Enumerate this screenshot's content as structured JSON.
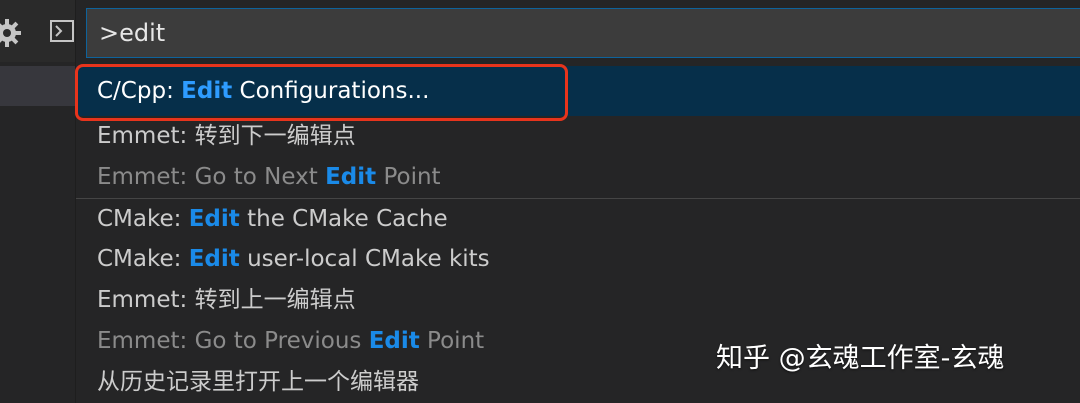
{
  "command_palette": {
    "input_value": ">edit",
    "items": [
      {
        "prefix": "C/Cpp: ",
        "match": "Edit",
        "suffix": " Configurations...",
        "selected": true
      },
      {
        "prefix": "Emmet: 转到下一编辑点",
        "match": "",
        "suffix": ""
      },
      {
        "prefix": "Emmet: Go to Next ",
        "match": "Edit",
        "suffix": " Point",
        "dim": true
      },
      {
        "prefix": "CMake: ",
        "match": "Edit",
        "suffix": " the CMake Cache",
        "separator": true
      },
      {
        "prefix": "CMake: ",
        "match": "Edit",
        "suffix": " user-local CMake kits"
      },
      {
        "prefix": "Emmet: 转到上一编辑点",
        "match": "",
        "suffix": ""
      },
      {
        "prefix": "Emmet: Go to Previous ",
        "match": "Edit",
        "suffix": " Point",
        "dim": true
      },
      {
        "prefix": "从历史记录里打开上一个编辑器",
        "match": "",
        "suffix": ""
      }
    ]
  },
  "activity_icons": [
    "gear-icon",
    "terminal-icon"
  ],
  "watermark": "知乎 @玄魂工作室-玄魂",
  "colors": {
    "accent": "#1a8ae8",
    "selection": "#062f4a",
    "input_border": "#0e639c",
    "annotation": "#e8341c"
  }
}
